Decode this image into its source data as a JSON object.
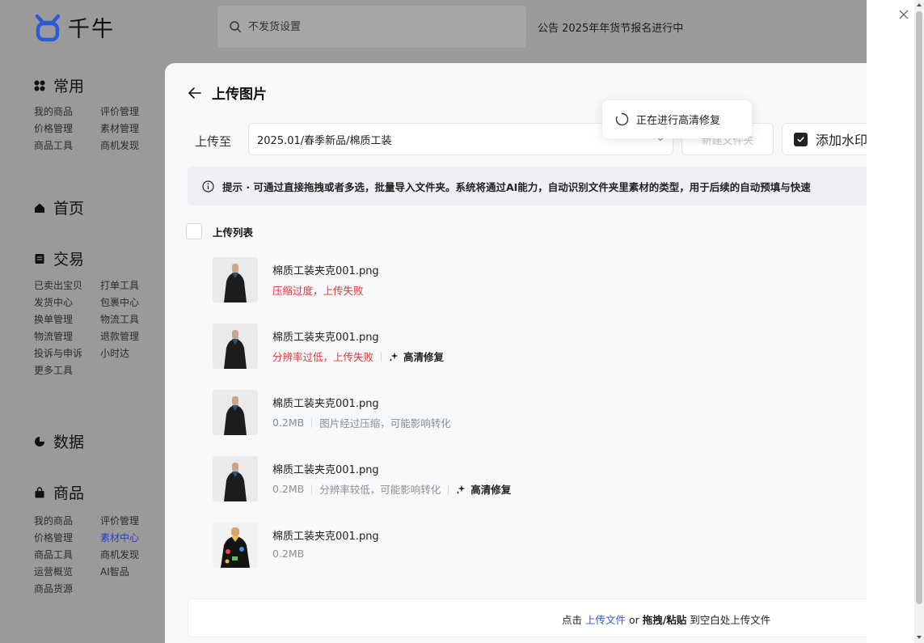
{
  "app": {
    "name": "千牛"
  },
  "search": {
    "placeholder": "不发货设置"
  },
  "notice": "公告 2025年年货节报名进行中",
  "sidebar": {
    "common": {
      "title": "常用",
      "links": [
        "我的商品",
        "评价管理",
        "价格管理",
        "素材管理",
        "商品工具",
        "商机发现"
      ]
    },
    "home": {
      "title": "首页"
    },
    "trade": {
      "title": "交易",
      "links": [
        "已卖出宝贝",
        "打单工具",
        "发货中心",
        "包裹中心",
        "换单管理",
        "物流工具",
        "物流管理",
        "退款管理",
        "投诉与申诉",
        "小时达",
        "更多工具"
      ]
    },
    "data": {
      "title": "数据"
    },
    "goods": {
      "title": "商品",
      "links": [
        "我的商品",
        "评价管理",
        "价格管理",
        "素材中心",
        "商品工具",
        "商机发现",
        "运营概览",
        "AI智品",
        "商品货源"
      ],
      "active": "素材中心"
    }
  },
  "panel": {
    "title": "上传图片",
    "upload_to_label": "上传至",
    "path_value": "2025.01/春季新品/棉质工装",
    "new_folder_label": "新建文件夹",
    "watermark_label": "添加水印",
    "watermark_checked": true,
    "toast": "正在进行高清修复",
    "tip": "提示 · 可通过直接拖拽或者多选，批量导入文件夹。系统将通过AI能力，自动识别文件夹里素材的类型，用于后续的自动预填与快速",
    "list_title": "上传列表",
    "items": [
      {
        "name": "棉质工装夹克001.png",
        "status": "压缩过度，上传失败",
        "status_type": "error",
        "detail": "",
        "action": ""
      },
      {
        "name": "棉质工装夹克001.png",
        "status": "分辨率过低，上传失败",
        "status_type": "error",
        "detail": "",
        "action": "高清修复"
      },
      {
        "name": "棉质工装夹克001.png",
        "status": "0.2MB",
        "status_type": "normal",
        "detail": "图片经过压缩，可能影响转化",
        "action": ""
      },
      {
        "name": "棉质工装夹克001.png",
        "status": "0.2MB",
        "status_type": "normal",
        "detail": "分辨率较低，可能影响转化",
        "action": "高清修复"
      },
      {
        "name": "棉质工装夹克001.png",
        "status": "0.2MB",
        "status_type": "normal",
        "detail": "",
        "action": ""
      }
    ],
    "dropzone": {
      "prefix": "点击 ",
      "link": "上传文件",
      "middle": " or ",
      "bold": "拖拽/粘贴",
      "suffix": " 到空白处上传文件"
    }
  },
  "colors": {
    "error": "#e0383e",
    "link": "#2a5bd7",
    "active": "#2a3cc9",
    "overlay": "#9a9a9a"
  }
}
